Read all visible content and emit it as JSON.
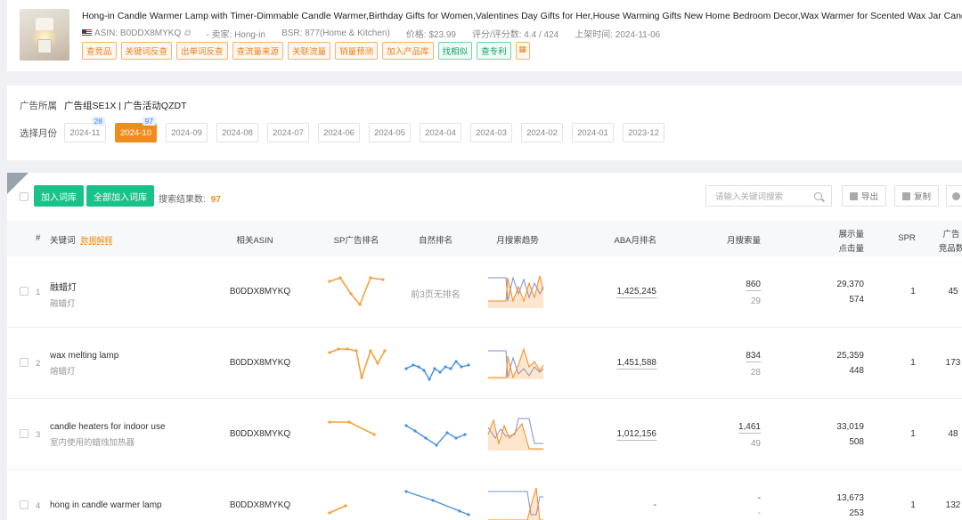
{
  "product": {
    "title": "Hong-in Candle Warmer Lamp with Timer-Dimmable Candle Warmer,Birthday Gifts for Women,Valentines Day Gifts for Her,House Warming Gifts New Home Bedroom Decor,Wax Warmer for Scented Wax Jar Candles",
    "asin": "ASIN: B0DDX8MYKQ",
    "seller": "- 卖家: Hong-in",
    "bsr": "BSR: 877(Home & Kitchen)",
    "price": "价格: $23.99",
    "rating": "评分/评分数: 4.4 / 424",
    "listed": "上架时间: 2024-11-06",
    "tags": [
      {
        "label": "查竞品",
        "style": "orange"
      },
      {
        "label": "关键词反查",
        "style": "orange"
      },
      {
        "label": "出单词反查",
        "style": "orange"
      },
      {
        "label": "查流量来源",
        "style": "orange"
      },
      {
        "label": "关联流量",
        "style": "orange"
      },
      {
        "label": "销量预测",
        "style": "orange"
      },
      {
        "label": "加入产品库",
        "style": "orange"
      },
      {
        "label": "找相似",
        "style": "green"
      },
      {
        "label": "查专利",
        "style": "green"
      }
    ]
  },
  "ad": {
    "label": "广告所属",
    "value": "广告组SE1X | 广告活动QZDT",
    "month_label": "选择月份",
    "months": [
      {
        "label": "2024-11",
        "badge": "28",
        "active": false
      },
      {
        "label": "2024-10",
        "badge": "97",
        "active": true
      },
      {
        "label": "2024-09",
        "badge": "",
        "active": false
      },
      {
        "label": "2024-08",
        "badge": "",
        "active": false
      },
      {
        "label": "2024-07",
        "badge": "",
        "active": false
      },
      {
        "label": "2024-06",
        "badge": "",
        "active": false
      },
      {
        "label": "2024-05",
        "badge": "",
        "active": false
      },
      {
        "label": "2024-04",
        "badge": "",
        "active": false
      },
      {
        "label": "2024-03",
        "badge": "",
        "active": false
      },
      {
        "label": "2024-02",
        "badge": "",
        "active": false
      },
      {
        "label": "2024-01",
        "badge": "",
        "active": false
      },
      {
        "label": "2023-12",
        "badge": "",
        "active": false
      }
    ]
  },
  "toolbar": {
    "add_label": "加入词库",
    "add_all_label": "全部加入词库",
    "result_label": "搜索结果数:",
    "result_count": "97",
    "search_placeholder": "请输入关键词搜索",
    "export_label": "导出",
    "copy_label": "复制"
  },
  "headers": {
    "index": "#",
    "keyword": "关键词",
    "keyword_hint": "数据解释",
    "asin": "相关ASIN",
    "sp_rank": "SP广告排名",
    "natural_rank": "自然排名",
    "trend": "月搜索趋势",
    "aba": "ABA月排名",
    "volume": "月搜索量",
    "impressions": "展示量",
    "clicks": "点击量",
    "spr": "SPR",
    "ad_label_1": "广告",
    "ad_label_2": "竞品数"
  },
  "colors": {
    "accent": "#f28b1e",
    "green": "#19c28a",
    "sp_line": "#f5a13a",
    "natural_line": "#4a90e2",
    "trend_a": "#f28b1e",
    "trend_b": "#7b8fd6"
  },
  "rows": [
    {
      "index": "1",
      "keyword_en": "融蜡灯",
      "keyword_cn": "融蜡灯",
      "asin": "B0DDX8MYKQ",
      "natural_text": "前3页无排名",
      "aba": "1,425,245",
      "volume": "860",
      "volume_sub": "29",
      "impressions": "29,370",
      "clicks": "574",
      "spr": "1",
      "competitors": "45"
    },
    {
      "index": "2",
      "keyword_en": "wax melting lamp",
      "keyword_cn": "熔蜡灯",
      "asin": "B0DDX8MYKQ",
      "natural_text": "",
      "aba": "1,451,588",
      "volume": "834",
      "volume_sub": "28",
      "impressions": "25,359",
      "clicks": "448",
      "spr": "1",
      "competitors": "173"
    },
    {
      "index": "3",
      "keyword_en": "candle heaters for indoor use",
      "keyword_cn": "室内使用的蜡烛加热器",
      "asin": "B0DDX8MYKQ",
      "natural_text": "",
      "aba": "1,012,156",
      "volume": "1,461",
      "volume_sub": "49",
      "impressions": "33,019",
      "clicks": "508",
      "spr": "1",
      "competitors": "48"
    },
    {
      "index": "4",
      "keyword_en": "hong in candle warmer lamp",
      "keyword_cn": "",
      "asin": "B0DDX8MYKQ",
      "natural_text": "",
      "aba": "-",
      "volume": "-",
      "volume_sub": "-",
      "impressions": "13,673",
      "clicks": "253",
      "spr": "1",
      "competitors": "132"
    }
  ]
}
